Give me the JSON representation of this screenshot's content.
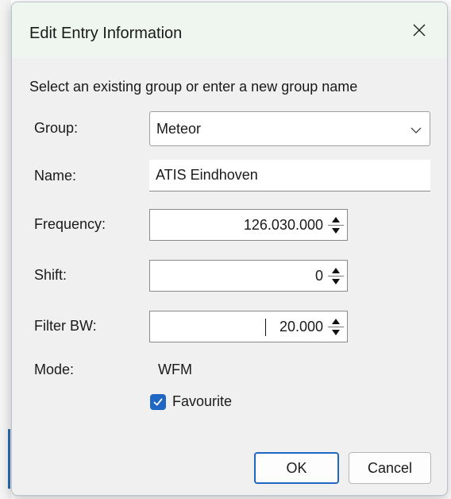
{
  "dialog": {
    "title": "Edit Entry Information",
    "instruction": "Select an existing group or enter a new group name"
  },
  "form": {
    "group": {
      "label": "Group:",
      "value": "Meteor"
    },
    "name": {
      "label": "Name:",
      "value": "ATIS Eindhoven"
    },
    "frequency": {
      "label": "Frequency:",
      "value": "126.030.000"
    },
    "shift": {
      "label": "Shift:",
      "value": "0"
    },
    "filter_bw": {
      "label": "Filter BW:",
      "value": "20.000"
    },
    "mode": {
      "label": "Mode:",
      "value": "WFM"
    },
    "favourite": {
      "label": "Favourite",
      "checked": true
    }
  },
  "buttons": {
    "ok": "OK",
    "cancel": "Cancel"
  },
  "icons": {
    "close": "close-icon",
    "dropdown": "chevron-down-icon",
    "spin_up": "spin-up-icon",
    "spin_down": "spin-down-icon",
    "check": "checkmark-icon"
  },
  "colors": {
    "accent": "#1f67c2",
    "title_bar": "#eef6ef",
    "dialog_bg": "#f0f0f0"
  }
}
